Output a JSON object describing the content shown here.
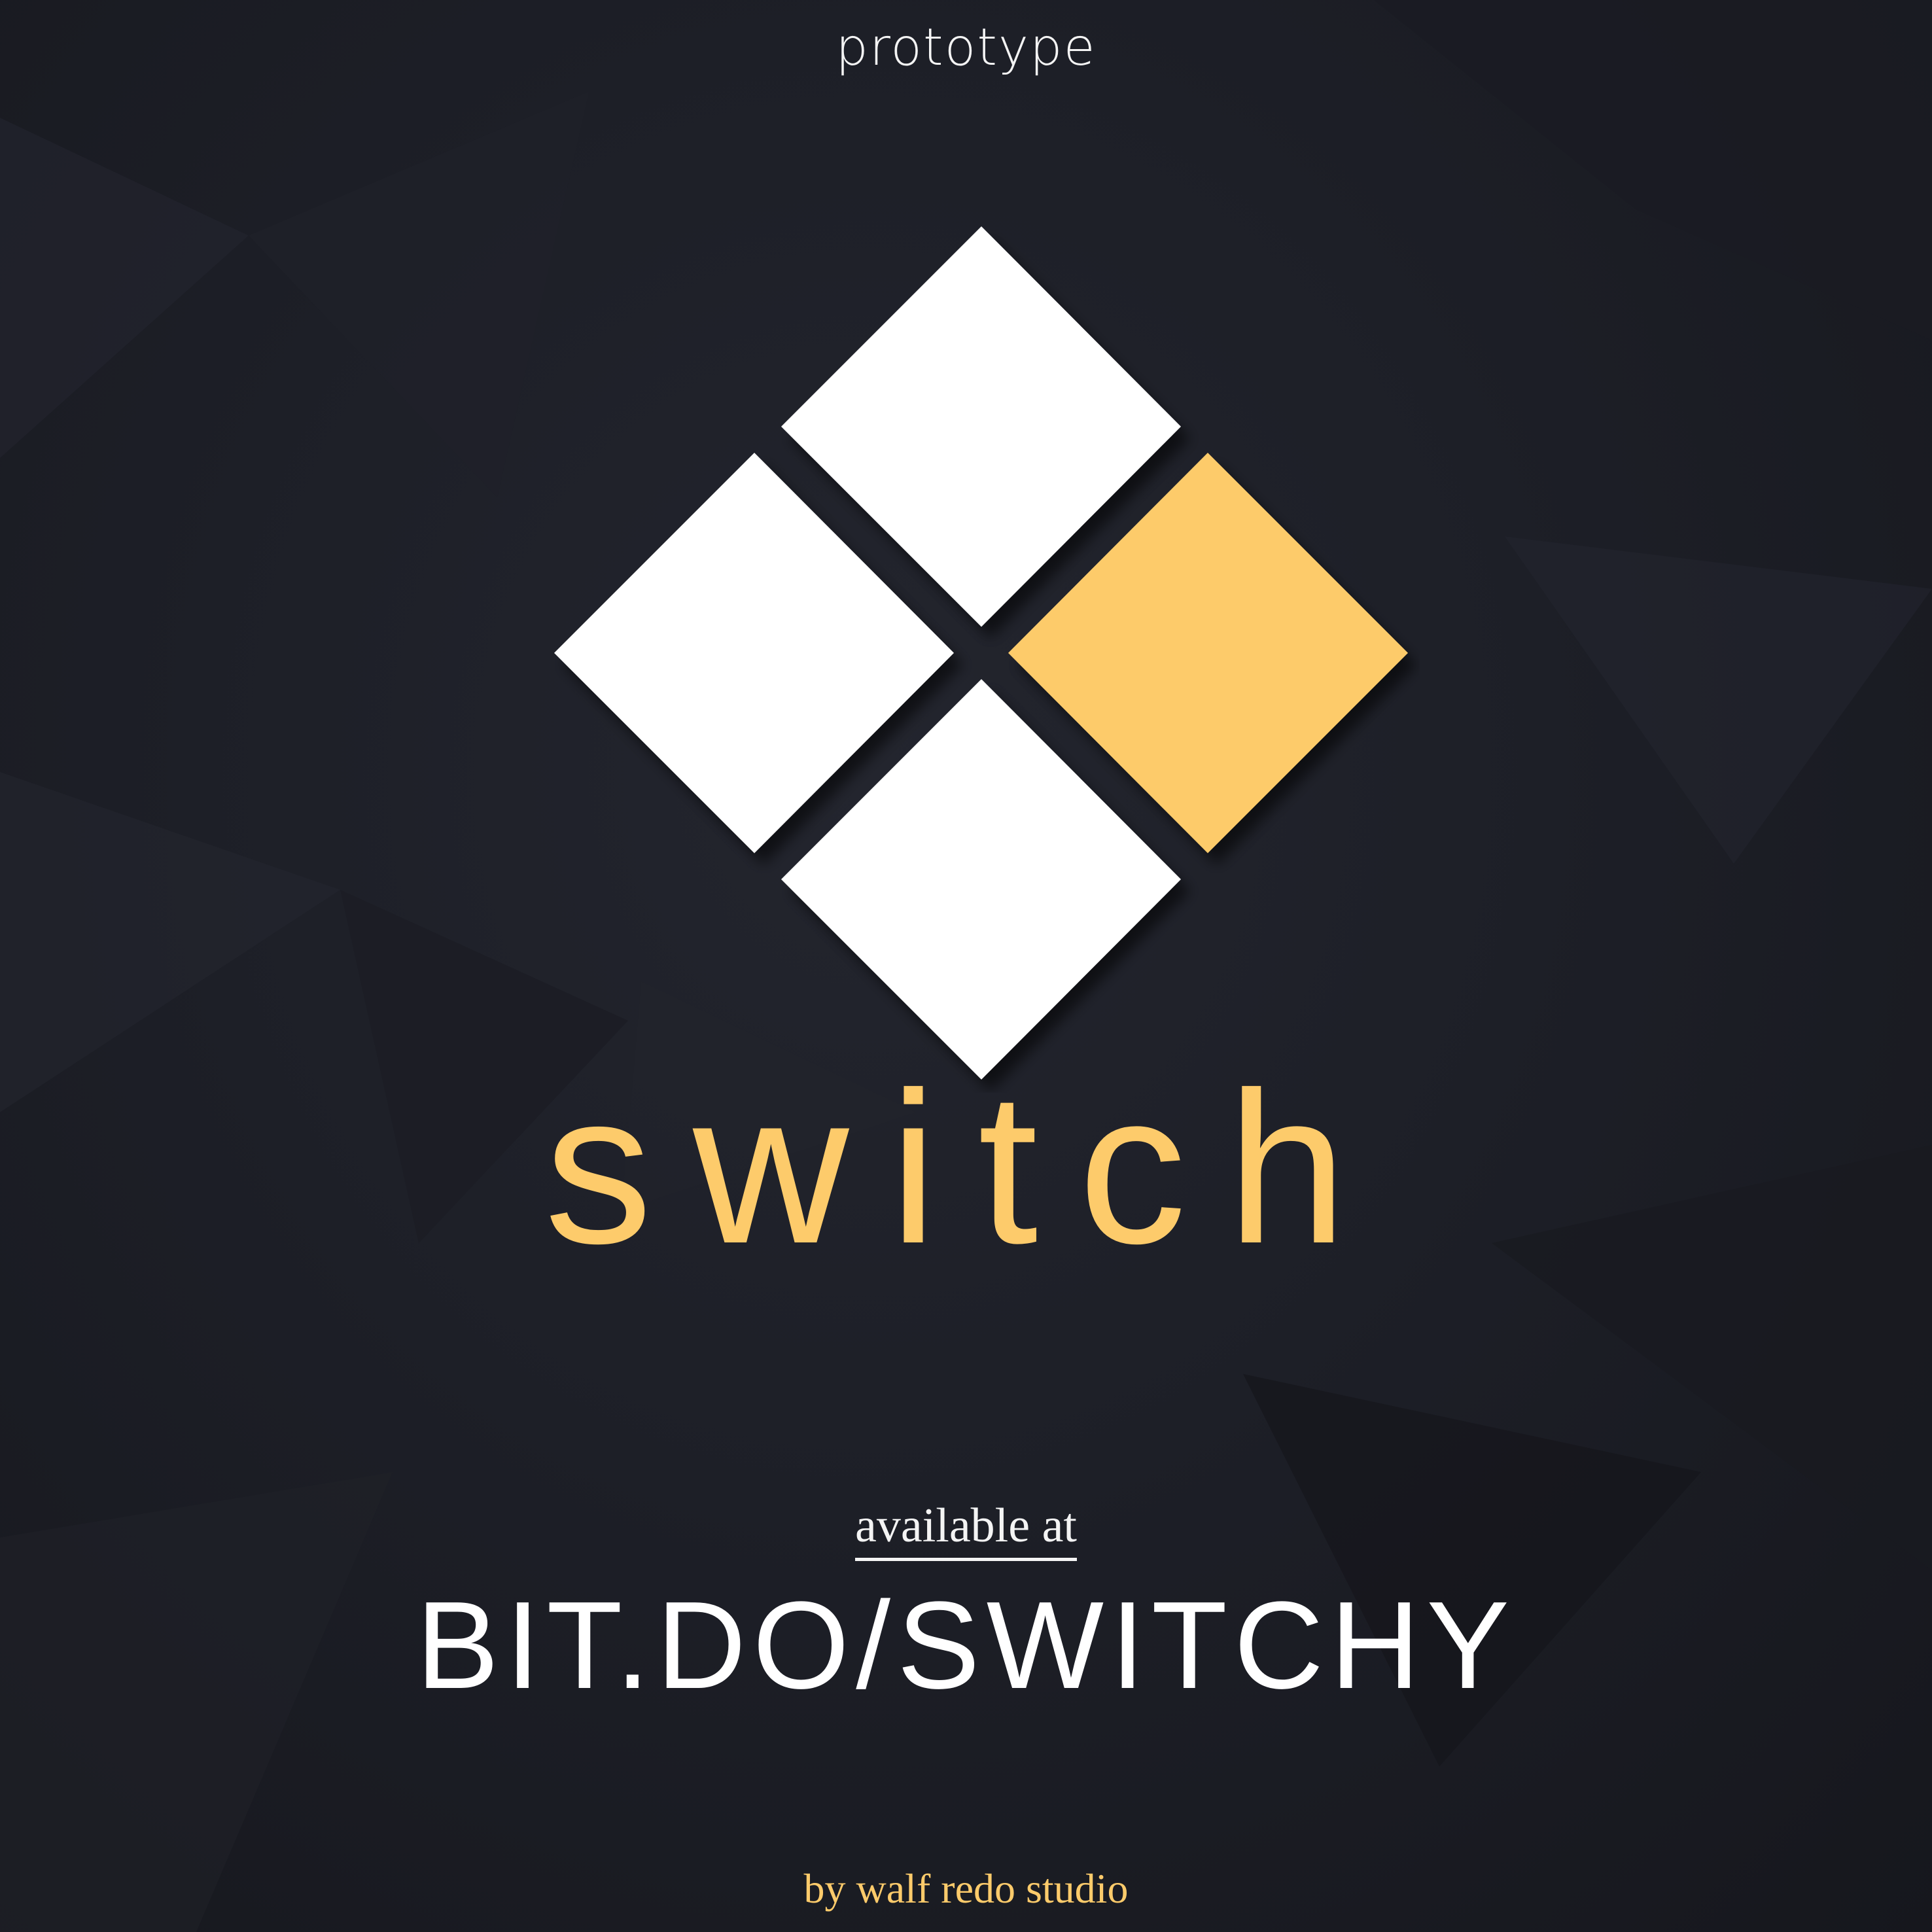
{
  "header": {
    "label": "prototype"
  },
  "logo": {
    "tiles": [
      "white",
      "white",
      "yellow",
      "white"
    ],
    "colors": {
      "white": "#ffffff",
      "accent": "#fdcb6b",
      "background": "#1c1e26"
    }
  },
  "brand": {
    "name": "switch"
  },
  "availability": {
    "intro": "available at",
    "url": "BIT.DO/SWITCHY"
  },
  "footer": {
    "credit": "by walf redo studio"
  }
}
